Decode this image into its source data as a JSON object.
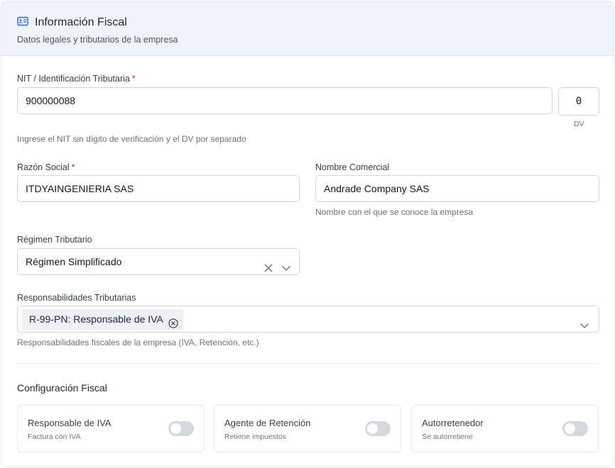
{
  "header": {
    "icon": "id-card-icon",
    "title": "Información Fiscal",
    "subtitle": "Datos legales y tributarios de la empresa"
  },
  "nit": {
    "label": "NIT / Identificación Tributaria",
    "required_mark": "*",
    "value": "900000088",
    "dv_value": "0",
    "dv_caption": "DV",
    "help": "Ingrese el NIT sin dígito de verificación y el DV por separado"
  },
  "razon_social": {
    "label": "Razón Social",
    "required_mark": "*",
    "value": "ITDYAINGENIERIA SAS"
  },
  "nombre_comercial": {
    "label": "Nombre Comercial",
    "value": "Andrade Company SAS",
    "help": "Nombre con el que se conoce la empresa"
  },
  "regimen": {
    "label": "Régimen Tributario",
    "value": "Régimen Simplificado"
  },
  "responsabilidades": {
    "label": "Responsabilidades Tributarias",
    "selected": [
      "R-99-PN: Responsable de IVA"
    ],
    "help": "Responsabilidades fiscales de la empresa (IVA, Retención, etc.)"
  },
  "config": {
    "title": "Configuración Fiscal",
    "toggles": [
      {
        "title": "Responsable de IVA",
        "subtitle": "Factura con IVA",
        "checked": false
      },
      {
        "title": "Agente de Retención",
        "subtitle": "Retiene impuestos",
        "checked": false
      },
      {
        "title": "Autorretenedor",
        "subtitle": "Se autorretiene",
        "checked": false
      }
    ]
  },
  "colors": {
    "accent": "#2563eb",
    "header_bg": "#eef3fc",
    "required": "#dc2626",
    "toggle_off": "#d3d8de"
  }
}
